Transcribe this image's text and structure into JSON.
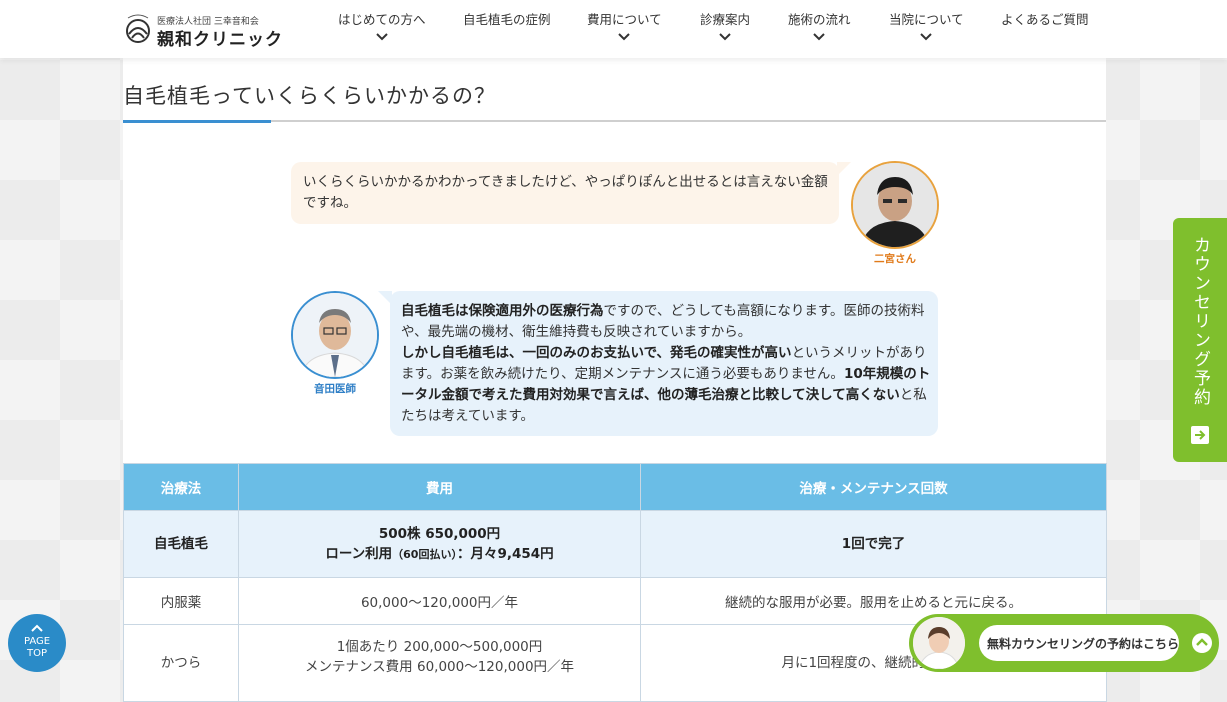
{
  "header": {
    "logo_sub": "医療法人社団 三幸音和会",
    "logo_main": "親和クリニック",
    "nav": [
      {
        "label": "はじめての方へ",
        "has_dropdown": true
      },
      {
        "label": "自毛植毛の症例",
        "has_dropdown": false
      },
      {
        "label": "費用について",
        "has_dropdown": true
      },
      {
        "label": "診療案内",
        "has_dropdown": true
      },
      {
        "label": "施術の流れ",
        "has_dropdown": true
      },
      {
        "label": "当院について",
        "has_dropdown": true
      },
      {
        "label": "よくあるご質問",
        "has_dropdown": false
      }
    ]
  },
  "page": {
    "title": "自毛植毛っていくらくらいかかるの？"
  },
  "conversation": {
    "patient": {
      "name": "二宮さん",
      "text": "いくらくらいかかるかわかってきましたけど、やっぱりぽんと出せるとは言えない金額ですね。"
    },
    "doctor": {
      "name": "音田医師",
      "p1_bold": "自毛植毛は保険適用外の医療行為",
      "p1_rest": "ですので、どうしても高額になります。医師の技術料や、最先端の機材、衛生維持費も反映されていますから。",
      "p2_bold": "しかし自毛植毛は、一回のみのお支払いで、発毛の確実性が高い",
      "p2_mid": "というメリットがあります。お薬を飲み続けたり、定期メンテナンスに通う必要もありません。",
      "p2_bold2": "10年規模のトータル金額で考えた費用対効果で言えば、他の薄毛治療と比較して決して高くない",
      "p2_end": "と私たちは考えています。"
    }
  },
  "table": {
    "headers": [
      "治療法",
      "費用",
      "治療・メンテナンス回数"
    ],
    "rows": [
      {
        "method": "自毛植毛",
        "cost_line1": "500株 650,000円",
        "cost_line2_a": "ローン利用",
        "cost_line2_small": "（60回払い）",
        "cost_line2_b": "：月々9,454円",
        "count": "1回で完了"
      },
      {
        "method": "内服薬",
        "cost": "60,000〜120,000円／年",
        "count": "継続的な服用が必要。服用を止めると元に戻る。"
      },
      {
        "method": "かつら",
        "cost_line1": "1個あたり 200,000〜500,000円",
        "cost_line2": "メンテナンス費用 60,000〜120,000円／年",
        "count": "月に1回程度の、継続的なメン"
      }
    ]
  },
  "side_cta": {
    "label": "カウンセリング予約"
  },
  "page_top": {
    "line1": "PAGE",
    "line2": "TOP"
  },
  "bottom_cta": {
    "label": "無料カウンセリングの予約はこちら"
  },
  "colors": {
    "accent_blue": "#3a8fd1",
    "table_header": "#6abde6",
    "cta_green": "#7fbf2d",
    "patient_bubble": "#fdf4ea",
    "doctor_bubble": "#e7f2fb"
  }
}
